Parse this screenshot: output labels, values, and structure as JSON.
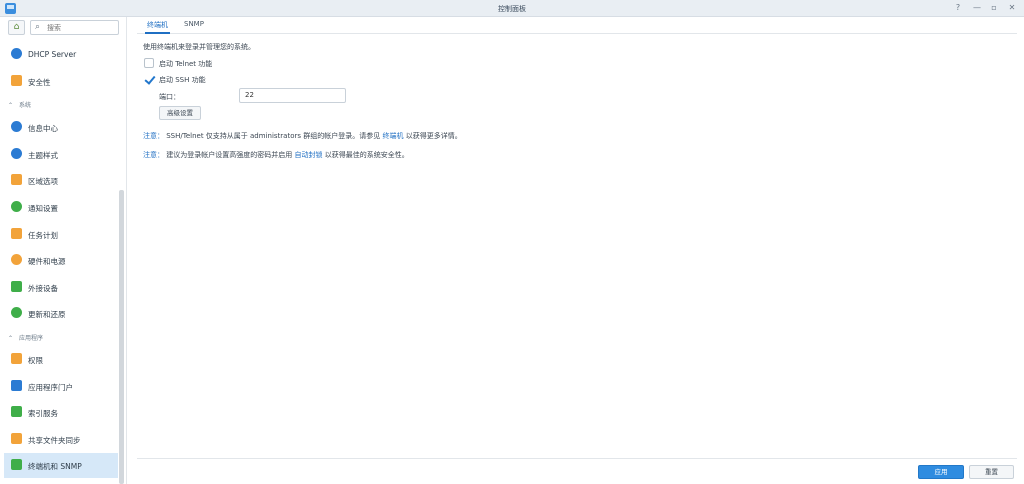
{
  "window": {
    "title": "控制面板",
    "help": "?",
    "minimize": "—",
    "restore": "▫",
    "close": "✕"
  },
  "sidebar": {
    "search_placeholder": "搜索",
    "items": [
      {
        "label": "DHCP Server",
        "icon": "dhcp-icon",
        "color": "#2b7bd3"
      },
      {
        "label": "安全性",
        "icon": "shield-icon",
        "color": "#f2a33a"
      },
      {
        "label": "信息中心",
        "icon": "info-icon",
        "color": "#2b7bd3"
      },
      {
        "label": "主题样式",
        "icon": "theme-icon",
        "color": "#2b7bd3"
      },
      {
        "label": "区域选项",
        "icon": "region-icon",
        "color": "#f2a33a"
      },
      {
        "label": "通知设置",
        "icon": "chat-icon",
        "color": "#3fae49"
      },
      {
        "label": "任务计划",
        "icon": "task-icon",
        "color": "#f2a33a"
      },
      {
        "label": "硬件和电源",
        "icon": "bulb-icon",
        "color": "#f2a33a"
      },
      {
        "label": "外接设备",
        "icon": "usb-icon",
        "color": "#3fae49"
      },
      {
        "label": "更新和还原",
        "icon": "update-icon",
        "color": "#3fae49"
      },
      {
        "label": "权限",
        "icon": "grid-icon",
        "color": "#f2a33a"
      },
      {
        "label": "应用程序门户",
        "icon": "portal-icon",
        "color": "#2b7bd3"
      },
      {
        "label": "索引服务",
        "icon": "index-icon",
        "color": "#3fae49"
      },
      {
        "label": "共享文件夹同步",
        "icon": "sync-icon",
        "color": "#f2a33a"
      },
      {
        "label": "终端机和 SNMP",
        "icon": "terminal-icon",
        "color": "#3fae49"
      }
    ],
    "groups": {
      "system": "系统",
      "apps": "应用程序"
    }
  },
  "tabs": [
    {
      "label": "终端机"
    },
    {
      "label": "SNMP"
    }
  ],
  "main": {
    "intro": "使用终端机来登录并管理您的系统。",
    "telnet_label": "启动 Telnet 功能",
    "ssh_label": "启动 SSH 功能",
    "telnet_checked": false,
    "ssh_checked": true,
    "port_label": "端口：",
    "port_value": "22",
    "advanced_button": "高级设置",
    "note1": {
      "prefix": "注意：",
      "text": "SSH/Telnet 仅支持从属于 administrators 群组的帐户登录。请参见",
      "link": "终端机",
      "suffix": "以获得更多详情。"
    },
    "note2": {
      "prefix": "注意：",
      "text": "建议为登录帐户设置高强度的密码并启用",
      "link": "自动封锁",
      "suffix": "以获得最佳的系统安全性。"
    }
  },
  "footer": {
    "apply": "应用",
    "reset": "重置"
  }
}
